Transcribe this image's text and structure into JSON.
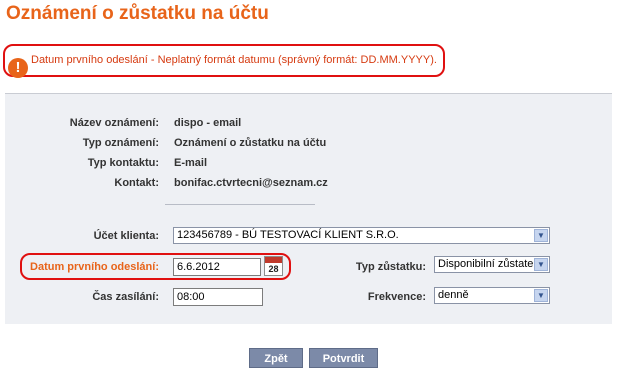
{
  "page": {
    "title": "Oznámení o zůstatku na účtu"
  },
  "error": {
    "message": "Datum prvního odeslání - Neplatný formát datumu (správný formát: DD.MM.YYYY).",
    "icon": "warning-icon",
    "color": "#e8641a"
  },
  "details": [
    {
      "label": "Název oznámení:",
      "value": "dispo - email"
    },
    {
      "label": "Typ oznámení:",
      "value": "Oznámení o zůstatku na účtu"
    },
    {
      "label": "Typ kontaktu:",
      "value": "E-mail"
    },
    {
      "label": "Kontakt:",
      "value": "bonifac.ctvrtecni@seznam.cz"
    }
  ],
  "form": {
    "account_label": "Účet klienta:",
    "account_value": "123456789 - BÚ TESTOVACÍ KLIENT S.R.O.",
    "date_label": "Datum prvního odeslání:",
    "date_value": "6.6.2012",
    "calendar_day": "28",
    "time_label": "Čas zasílání:",
    "time_value": "08:00",
    "balance_type_label": "Typ zůstatku:",
    "balance_type_value": "Disponibilní zůstate",
    "frequency_label": "Frekvence:",
    "frequency_value": "denně"
  },
  "buttons": {
    "back": "Zpět",
    "confirm": "Potvrdit"
  },
  "colors": {
    "accent": "#e8641a",
    "error_border": "#e01010",
    "panel": "#eef0f4",
    "button": "#7c8aa8"
  }
}
